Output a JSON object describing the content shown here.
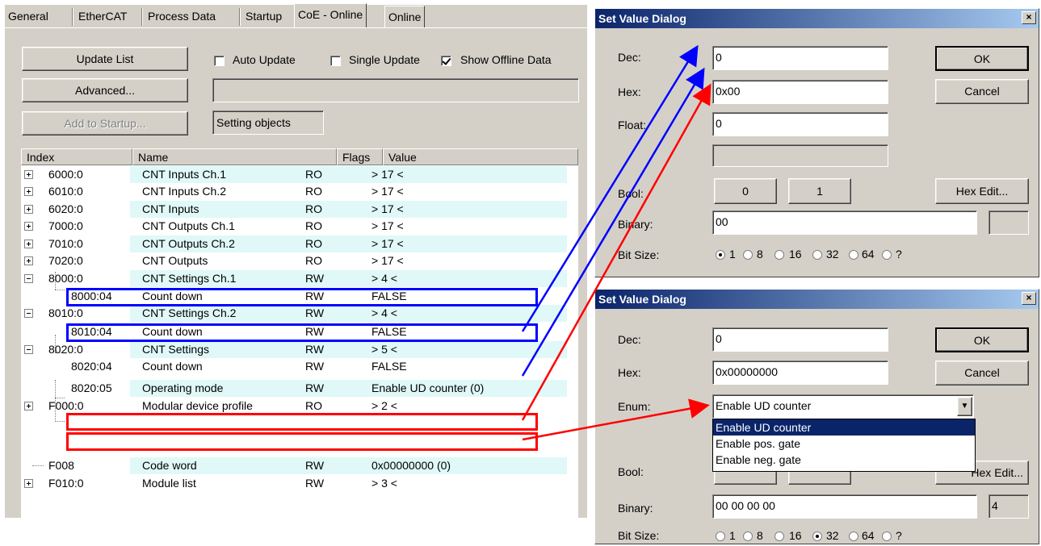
{
  "tabs": [
    "General",
    "EtherCAT",
    "Process Data",
    "Startup",
    "CoE - Online",
    "Online"
  ],
  "buttons": {
    "update_list": "Update List",
    "advanced": "Advanced...",
    "add_to_startup": "Add to Startup..."
  },
  "checkboxes": {
    "auto_update": "Auto Update",
    "single_update": "Single Update",
    "show_offline": "Show Offline Data"
  },
  "status_text": "Setting objects",
  "columns": {
    "index": "Index",
    "name": "Name",
    "flags": "Flags",
    "value": "Value"
  },
  "rows": [
    {
      "index": "6000:0",
      "name": "CNT Inputs Ch.1",
      "flags": "RO",
      "value": "> 17 <"
    },
    {
      "index": "6010:0",
      "name": "CNT Inputs Ch.2",
      "flags": "RO",
      "value": "> 17 <"
    },
    {
      "index": "6020:0",
      "name": "CNT Inputs",
      "flags": "RO",
      "value": "> 17 <"
    },
    {
      "index": "7000:0",
      "name": "CNT Outputs Ch.1",
      "flags": "RO",
      "value": "> 17 <"
    },
    {
      "index": "7010:0",
      "name": "CNT Outputs Ch.2",
      "flags": "RO",
      "value": "> 17 <"
    },
    {
      "index": "7020:0",
      "name": "CNT Outputs",
      "flags": "RO",
      "value": "> 17 <"
    },
    {
      "index": "8000:0",
      "name": "CNT Settings Ch.1",
      "flags": "RW",
      "value": "> 4 <"
    },
    {
      "index": "8000:04",
      "name": "Count down",
      "flags": "RW",
      "value": "FALSE"
    },
    {
      "index": "8010:0",
      "name": "CNT Settings Ch.2",
      "flags": "RW",
      "value": "> 4 <"
    },
    {
      "index": "8010:04",
      "name": "Count down",
      "flags": "RW",
      "value": "FALSE"
    },
    {
      "index": "8020:0",
      "name": "CNT Settings",
      "flags": "RW",
      "value": "> 5 <"
    },
    {
      "index": "8020:04",
      "name": "Count down",
      "flags": "RW",
      "value": "FALSE"
    },
    {
      "index": "8020:05",
      "name": "Operating mode",
      "flags": "RW",
      "value": "Enable UD counter (0)"
    },
    {
      "index": "F000:0",
      "name": "Modular device profile",
      "flags": "RO",
      "value": "> 2 <"
    },
    {
      "index": "F008",
      "name": "Code word",
      "flags": "RW",
      "value": "0x00000000 (0)"
    },
    {
      "index": "F010:0",
      "name": "Module list",
      "flags": "RW",
      "value": "> 3 <"
    }
  ],
  "dialog1": {
    "title": "Set Value Dialog",
    "close": "×",
    "labels": {
      "dec": "Dec:",
      "hex": "Hex:",
      "float": "Float:",
      "bool": "Bool:",
      "binary": "Binary:",
      "bitsize": "Bit Size:"
    },
    "values": {
      "dec": "0",
      "hex": "0x00",
      "float": "0",
      "binary": "00"
    },
    "buttons": {
      "ok": "OK",
      "cancel": "Cancel",
      "b0": "0",
      "b1": "1",
      "hex_edit": "Hex Edit..."
    },
    "bit_sizes": [
      "1",
      "8",
      "16",
      "32",
      "64",
      "?"
    ],
    "selected_bit_size": "1"
  },
  "dialog2": {
    "title": "Set Value Dialog",
    "close": "×",
    "labels": {
      "dec": "Dec:",
      "hex": "Hex:",
      "enum": "Enum:",
      "bool": "Bool:",
      "binary": "Binary:",
      "bitsize": "Bit Size:"
    },
    "values": {
      "dec": "0",
      "hex": "0x00000000",
      "enum": "Enable UD counter",
      "binary": "00 00 00 00",
      "size": "4"
    },
    "buttons": {
      "ok": "OK",
      "cancel": "Cancel",
      "hex_edit": "Hex Edit..."
    },
    "enum_options": [
      "Enable UD counter",
      "Enable pos. gate",
      "Enable neg. gate"
    ],
    "bit_sizes": [
      "1",
      "8",
      "16",
      "32",
      "64",
      "?"
    ],
    "selected_bit_size": "32"
  },
  "colors": {
    "blue_arrow": "#0000ff",
    "red_arrow": "#ff0000",
    "title_start": "#0a246a",
    "title_end": "#a6caf0",
    "row_band": "#e0f8f8"
  }
}
